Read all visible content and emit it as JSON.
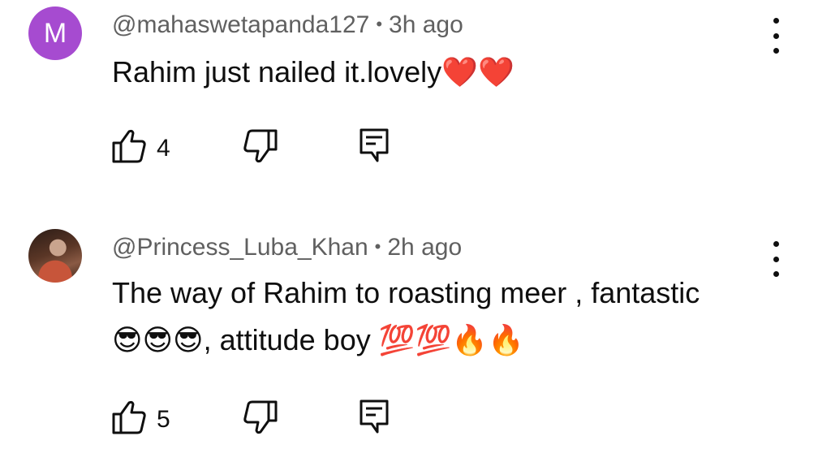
{
  "comments": [
    {
      "avatar_letter": "M",
      "handle": "@mahaswetapanda127",
      "separator": "•",
      "time": "3h ago",
      "text_line1": "Rahim just nailed it.lovely❤️❤️",
      "text_line2": "",
      "likes": "4",
      "icons": [
        "like-icon",
        "dislike-icon",
        "reply-icon",
        "more-options-icon"
      ]
    },
    {
      "avatar_letter": "",
      "handle": "@Princess_Luba_Khan",
      "separator": "•",
      "time": "2h ago",
      "text_line1": "The way of Rahim to roasting meer , fantastic",
      "text_line2": "😎😎😎, attitude boy 💯💯🔥🔥",
      "likes": "5",
      "icons": [
        "like-icon",
        "dislike-icon",
        "reply-icon",
        "more-options-icon"
      ]
    }
  ],
  "colors": {
    "avatar_m_bg": "#a64bd0",
    "meta_text": "#606060",
    "body_text": "#0f0f0f"
  }
}
